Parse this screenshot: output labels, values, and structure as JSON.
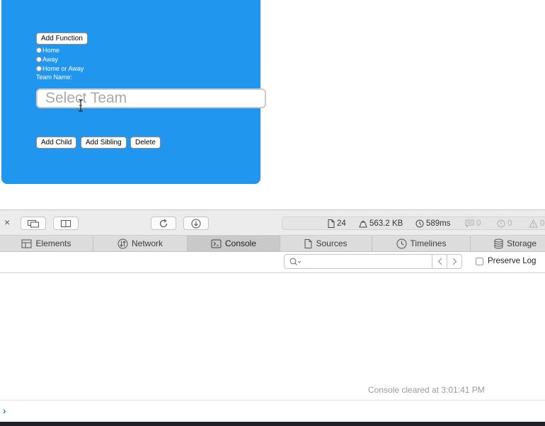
{
  "page": {
    "add_function_label": "Add Function",
    "radios": [
      "Home",
      "Away",
      "Home or Away"
    ],
    "team_name_label": "Team Name:",
    "team_input_placeholder": "Select Team",
    "add_child_label": "Add Child",
    "add_sibling_label": "Add Sibling",
    "delete_label": "Delete",
    "card_color": "#2196ee"
  },
  "devtools": {
    "toolbar": {
      "close_glyph": "×",
      "resources_count": "24",
      "transfer_size": "563.2 KB",
      "load_time": "589ms",
      "messages_count": "0",
      "errors_count": "0",
      "warnings_count": "0"
    },
    "tabs": [
      {
        "label": "Elements",
        "icon": "elements-icon"
      },
      {
        "label": "Network",
        "icon": "network-icon"
      },
      {
        "label": "Console",
        "icon": "console-icon",
        "active": true
      },
      {
        "label": "Sources",
        "icon": "sources-icon"
      },
      {
        "label": "Timelines",
        "icon": "timelines-icon"
      },
      {
        "label": "Storage",
        "icon": "storage-icon"
      }
    ],
    "filter": {
      "search_placeholder": "",
      "preserve_log_label": "Preserve Log",
      "preserve_log_checked": false
    },
    "console": {
      "cleared_message": "Console cleared at 3:01:41 PM",
      "prompt_glyph": "›",
      "prompt_color": "#2a6ee8"
    }
  }
}
